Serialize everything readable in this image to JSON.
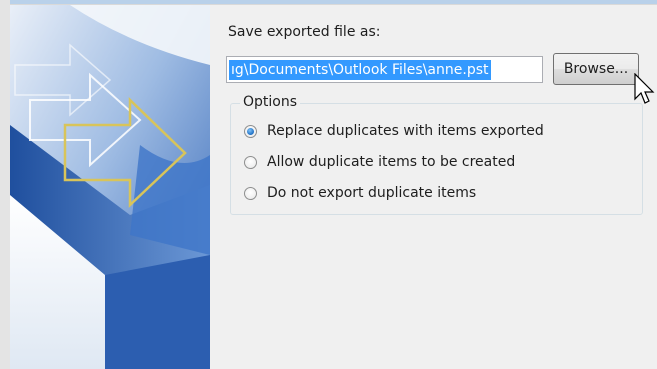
{
  "save_section": {
    "label": "Save exported file as:",
    "path_value": "ıg\\Documents\\Outlook Files\\anne.pst",
    "browse_label": "Browse..."
  },
  "options": {
    "legend": "Options",
    "items": [
      {
        "label": "Replace duplicates with items exported",
        "checked": true
      },
      {
        "label": "Allow duplicate items to be created",
        "checked": false
      },
      {
        "label": "Do not export duplicate items",
        "checked": false
      }
    ]
  },
  "colors": {
    "selection": "#3399ff",
    "banner_blue": "#2a63b8",
    "arrow_yellow": "#d8c45a"
  }
}
